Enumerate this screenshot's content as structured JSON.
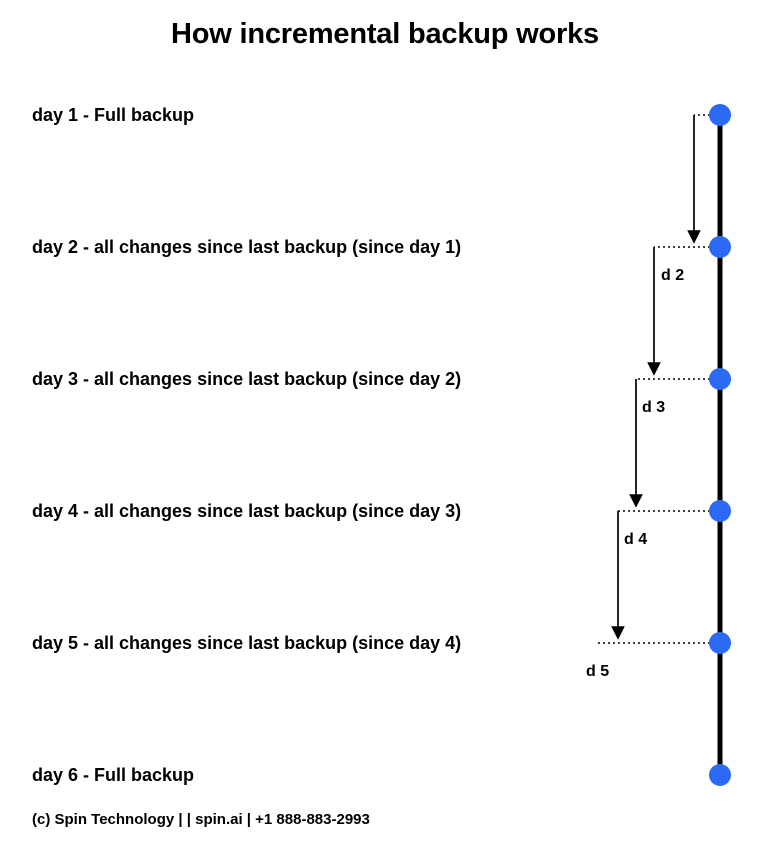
{
  "title": "How incremental backup works",
  "rows": {
    "day1": "day 1 - Full backup",
    "day2": "day 2 - all changes since last backup (since day 1)",
    "day3": "day 3 - all changes since last backup (since day 2)",
    "day4": "day 4 - all changes since last backup (since day 3)",
    "day5": "day 5 - all changes since last backup (since day 4)",
    "day6": "day 6 - Full backup"
  },
  "deltas": {
    "d2": "d 2",
    "d3": "d 3",
    "d4": "d 4",
    "d5": "d 5"
  },
  "footer": "(c) Spin Technology | | spin.ai | +1 888-883-2993",
  "colors": {
    "dot": "#2a6af4",
    "line": "#000000"
  }
}
